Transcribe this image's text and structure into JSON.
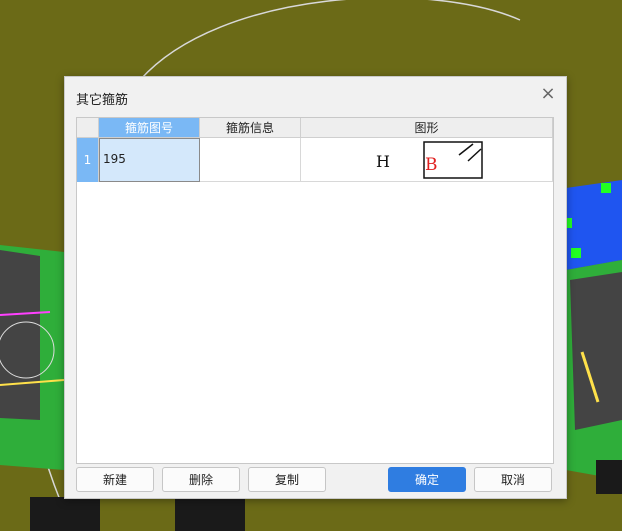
{
  "dialog": {
    "title": "其它箍筋",
    "columns": [
      "箍筋图号",
      "箍筋信息",
      "图形"
    ],
    "rows": [
      {
        "index": "1",
        "code": "195",
        "info": "",
        "shape_labels": {
          "h": "H",
          "b": "B"
        }
      }
    ],
    "buttons": {
      "new": "新建",
      "delete": "删除",
      "copy": "复制",
      "ok": "确定",
      "cancel": "取消"
    }
  },
  "colors": {
    "background": "#6b6a17",
    "selection": "#7ab8f5",
    "primary_button": "#2f7de1",
    "shape_b_label": "#e02020"
  },
  "icons": {
    "close": "close-icon"
  }
}
